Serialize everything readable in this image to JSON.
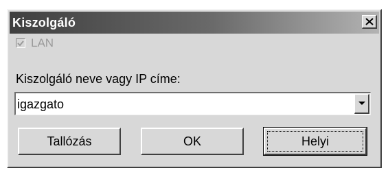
{
  "dialog": {
    "title": "Kiszolgáló",
    "close_label": "✕"
  },
  "lan": {
    "label": "LAN",
    "checked": true,
    "disabled": true
  },
  "server": {
    "label": "Kiszolgáló neve vagy IP címe:",
    "value": "igazgato"
  },
  "buttons": {
    "browse_label": "Tallózás",
    "ok_label": "OK",
    "local_label": "Helyi"
  },
  "colors": {
    "dialog_face": "#d8d8d8",
    "titlebar_start": "#3f3f3f",
    "titlebar_end": "#b3b3b3",
    "disabled_text": "#9a9a9a"
  }
}
